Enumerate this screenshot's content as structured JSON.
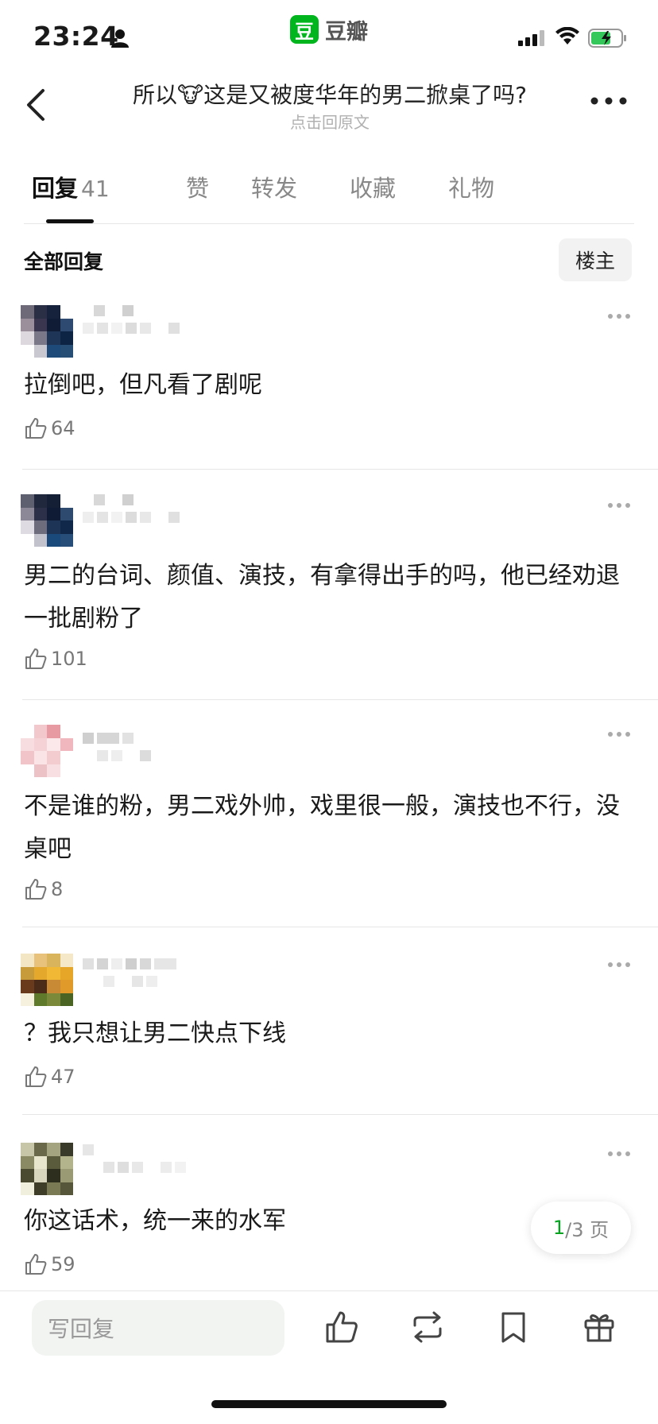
{
  "status_bar": {
    "time": "23:24",
    "app_name": "豆瓣",
    "app_logo_char": "豆",
    "brand_color": "#00b51d"
  },
  "header": {
    "title": "所以🐮这是又被度华年的男二掀桌了吗?",
    "subtitle": "点击回原文"
  },
  "tabs": [
    {
      "label": "回复",
      "count": "41",
      "active": true
    },
    {
      "label": "赞"
    },
    {
      "label": "转发"
    },
    {
      "label": "收藏"
    },
    {
      "label": "礼物"
    }
  ],
  "section": {
    "title": "全部回复",
    "op_button": "楼主"
  },
  "comments": [
    {
      "text": "拉倒吧，但凡看了剧呢",
      "likes": "64"
    },
    {
      "text": "男二的台词、颜值、演技，有拿得出手的吗，他已经劝退一批剧粉了",
      "likes": "101"
    },
    {
      "text": "不是谁的粉，男二戏外帅，戏里很一般，演技也不行，没桌吧",
      "likes": "8"
    },
    {
      "text": "？我只想让男二快点下线",
      "likes": "47"
    },
    {
      "text": "你这话术，统一来的水军",
      "likes": "59"
    }
  ],
  "pager": {
    "current": "1",
    "total_text": "/3 页"
  },
  "bottom_bar": {
    "reply_placeholder": "写回复",
    "icons": [
      "like-icon",
      "repost-icon",
      "bookmark-icon",
      "gift-icon"
    ]
  }
}
